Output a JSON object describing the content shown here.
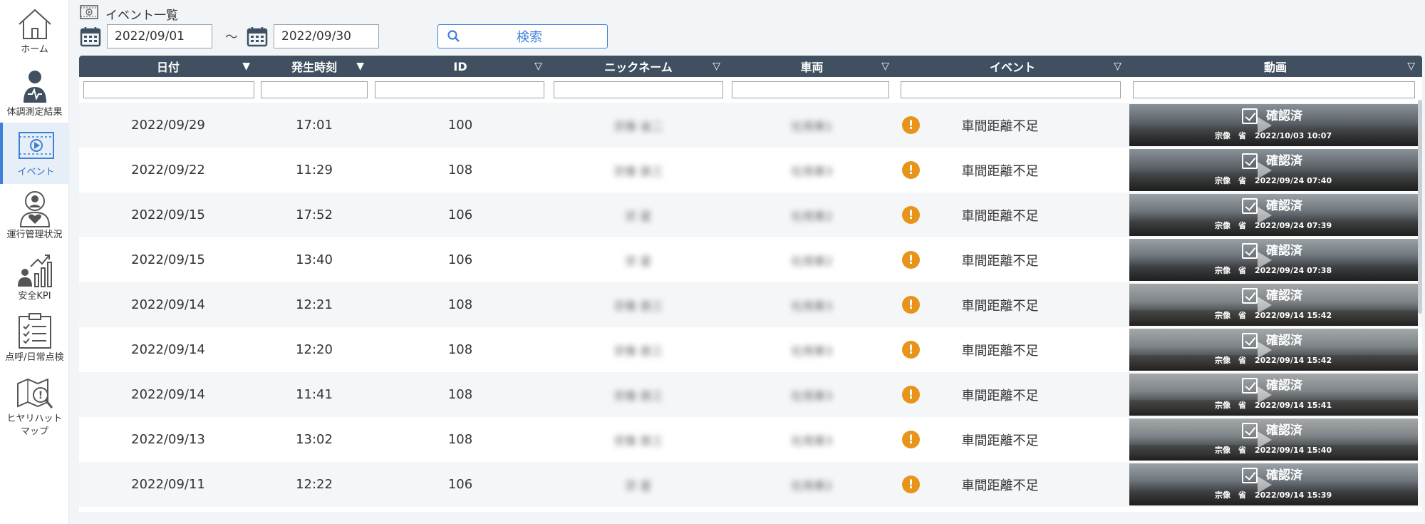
{
  "sidebar": {
    "items": [
      {
        "label": "ホーム",
        "icon": "home-icon",
        "active": false
      },
      {
        "label": "体調測定結果",
        "icon": "health-check-icon",
        "active": false
      },
      {
        "label": "イベント",
        "icon": "video-event-icon",
        "active": true
      },
      {
        "label": "運行管理状況",
        "icon": "driver-status-icon",
        "active": false
      },
      {
        "label": "安全KPI",
        "icon": "kpi-chart-icon",
        "active": false
      },
      {
        "label": "点呼/日常点検",
        "icon": "checklist-icon",
        "active": false
      },
      {
        "label": "ヒヤリハット\nマップ",
        "label_line1": "ヒヤリハット",
        "label_line2": "マップ",
        "icon": "near-miss-map-icon",
        "active": false
      }
    ]
  },
  "header": {
    "title": "イベント一覧",
    "date_from": "2022/09/01",
    "date_separator": "～",
    "date_to": "2022/09/30",
    "search_label": "検索"
  },
  "table": {
    "columns": [
      {
        "label": "日付",
        "sort": "▼"
      },
      {
        "label": "発生時刻",
        "sort": "▼"
      },
      {
        "label": "ID",
        "sort": "▽"
      },
      {
        "label": "ニックネーム",
        "sort": "▽"
      },
      {
        "label": "車両",
        "sort": "▽"
      },
      {
        "label": "イベント",
        "sort": "▽"
      },
      {
        "label": "動画",
        "sort": "▽"
      }
    ],
    "rows": [
      {
        "date": "2022/09/29",
        "time": "17:01",
        "id": "100",
        "nickname": "宗像 省二",
        "vehicle": "社用車1",
        "event": "車間距離不足",
        "video_status": "確認済",
        "video_by": "宗像　省",
        "video_at": "2022/10/03 10:07"
      },
      {
        "date": "2022/09/22",
        "time": "11:29",
        "id": "108",
        "nickname": "宗像 鉄三",
        "vehicle": "社用車3",
        "event": "車間距離不足",
        "video_status": "確認済",
        "video_by": "宗像　省",
        "video_at": "2022/09/24 07:40"
      },
      {
        "date": "2022/09/15",
        "time": "17:52",
        "id": "106",
        "nickname": "宗 星",
        "vehicle": "社用車2",
        "event": "車間距離不足",
        "video_status": "確認済",
        "video_by": "宗像　省",
        "video_at": "2022/09/24 07:39"
      },
      {
        "date": "2022/09/15",
        "time": "13:40",
        "id": "106",
        "nickname": "宗 星",
        "vehicle": "社用車2",
        "event": "車間距離不足",
        "video_status": "確認済",
        "video_by": "宗像　省",
        "video_at": "2022/09/24 07:38"
      },
      {
        "date": "2022/09/14",
        "time": "12:21",
        "id": "108",
        "nickname": "宗像 鉄三",
        "vehicle": "社用車3",
        "event": "車間距離不足",
        "video_status": "確認済",
        "video_by": "宗像　省",
        "video_at": "2022/09/14 15:42"
      },
      {
        "date": "2022/09/14",
        "time": "12:20",
        "id": "108",
        "nickname": "宗像 鉄三",
        "vehicle": "社用車3",
        "event": "車間距離不足",
        "video_status": "確認済",
        "video_by": "宗像　省",
        "video_at": "2022/09/14 15:42"
      },
      {
        "date": "2022/09/14",
        "time": "11:41",
        "id": "108",
        "nickname": "宗像 鉄三",
        "vehicle": "社用車3",
        "event": "車間距離不足",
        "video_status": "確認済",
        "video_by": "宗像　省",
        "video_at": "2022/09/14 15:41"
      },
      {
        "date": "2022/09/13",
        "time": "13:02",
        "id": "108",
        "nickname": "宗像 鉄三",
        "vehicle": "社用車3",
        "event": "車間距離不足",
        "video_status": "確認済",
        "video_by": "宗像　省",
        "video_at": "2022/09/14 15:40"
      },
      {
        "date": "2022/09/11",
        "time": "12:22",
        "id": "106",
        "nickname": "宗 星",
        "vehicle": "社用車2",
        "event": "車間距離不足",
        "video_status": "確認済",
        "video_by": "宗像　省",
        "video_at": "2022/09/14 15:39"
      }
    ]
  },
  "colors": {
    "accent": "#3f7fd8",
    "header_bg": "#405061",
    "warning": "#e8941a",
    "page_bg": "#f1f5f8"
  }
}
